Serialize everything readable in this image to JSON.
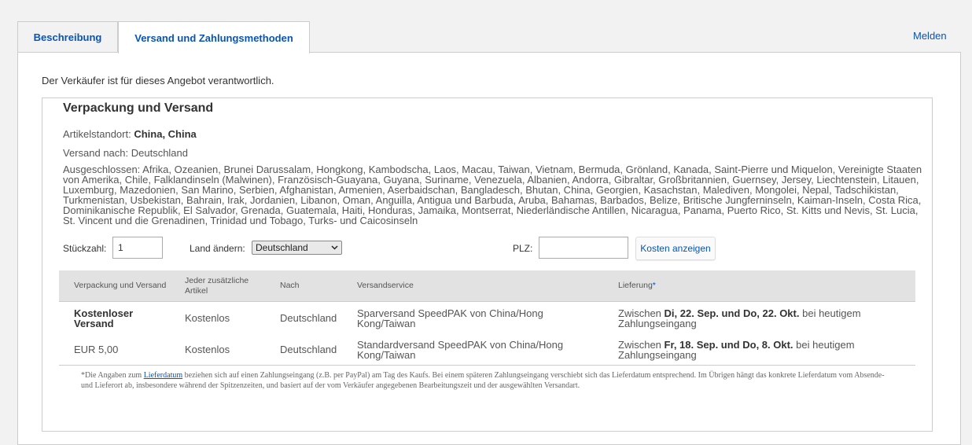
{
  "tabs": [
    {
      "label": "Beschreibung",
      "active": false
    },
    {
      "label": "Versand und Zahlungsmethoden",
      "active": true
    }
  ],
  "report_link": "Melden",
  "seller_note": "Der Verkäufer ist für dieses Angebot verantwortlich.",
  "shipping": {
    "title": "Verpackung und Versand",
    "item_location_label": "Artikelstandort:",
    "item_location_value": "China, China",
    "ships_to": "Versand nach: Deutschland",
    "excluded": "Ausgeschlossen: Afrika, Ozeanien, Brunei Darussalam, Hongkong, Kambodscha, Laos, Macau, Taiwan, Vietnam, Bermuda, Grönland, Kanada, Saint-Pierre und Miquelon, Vereinigte Staaten von Amerika, Chile, Falklandinseln (Malwinen), Französisch-Guayana, Guyana, Suriname, Venezuela, Albanien, Andorra, Gibraltar, Großbritannien, Guernsey, Jersey, Liechtenstein, Litauen, Luxemburg, Mazedonien, San Marino, Serbien, Afghanistan, Armenien, Aserbaidschan, Bangladesch, Bhutan, China, Georgien, Kasachstan, Malediven, Mongolei, Nepal, Tadschikistan, Turkmenistan, Usbekistan, Bahrain, Irak, Jordanien, Libanon, Oman, Anguilla, Antigua und Barbuda, Aruba, Bahamas, Barbados, Belize, Britische Jungferninseln, Kaiman-Inseln, Costa Rica, Dominikanische Republik, El Salvador, Grenada, Guatemala, Haiti, Honduras, Jamaika, Montserrat, Niederländische Antillen, Nicaragua, Panama, Puerto Rico, St. Kitts und Nevis, St. Lucia, St. Vincent und die Grenadinen, Trinidad und Tobago, Turks- und Caicosinseln"
  },
  "controls": {
    "qty_label": "Stückzahl:",
    "qty_value": "1",
    "country_label": "Land ändern:",
    "country_value": "Deutschland",
    "zip_label": "PLZ:",
    "zip_value": "",
    "calc_button": "Kosten anzeigen"
  },
  "table": {
    "headers": {
      "cost": "Verpackung und Versand",
      "each_additional": "Jeder zusätzliche Artikel",
      "to": "Nach",
      "service": "Versandservice",
      "delivery": "Lieferung",
      "delivery_asterisk": "*"
    },
    "rows": [
      {
        "cost": "Kostenloser Versand",
        "each_additional": "Kostenlos",
        "to": "Deutschland",
        "service": "Sparversand SpeedPAK von China/Hong Kong/Taiwan",
        "delivery_prefix": "Zwischen",
        "delivery_range": "Di, 22. Sep. und Do, 22. Okt.",
        "delivery_suffix": "bei heutigem Zahlungseingang"
      },
      {
        "cost": "EUR 5,00",
        "each_additional": "Kostenlos",
        "to": "Deutschland",
        "service": "Standardversand SpeedPAK von China/Hong Kong/Taiwan",
        "delivery_prefix": "Zwischen",
        "delivery_range": "Fr, 18. Sep. und Do, 8. Okt.",
        "delivery_suffix": "bei heutigem Zahlungseingang"
      }
    ],
    "footnote_prefix": "*Die Angaben zum",
    "footnote_link": "Lieferdatum",
    "footnote_suffix": "beziehen sich auf einen Zahlungseingang (z.B. per PayPal) am Tag des Kaufs. Bei einem späteren Zahlungseingang verschiebt sich das Lieferdatum entsprechend. Im Übrigen hängt das konkrete Lieferdatum vom Absende- und Lieferort ab, insbesondere während der Spitzenzeiten, und basiert auf der vom Verkäufer angegebenen Bearbeitungszeit und der ausgewählten Versandart."
  },
  "colors": {
    "link": "#0654ba",
    "table_header_bg": "#e2e2e2",
    "page_bg": "#f2f2f2"
  }
}
